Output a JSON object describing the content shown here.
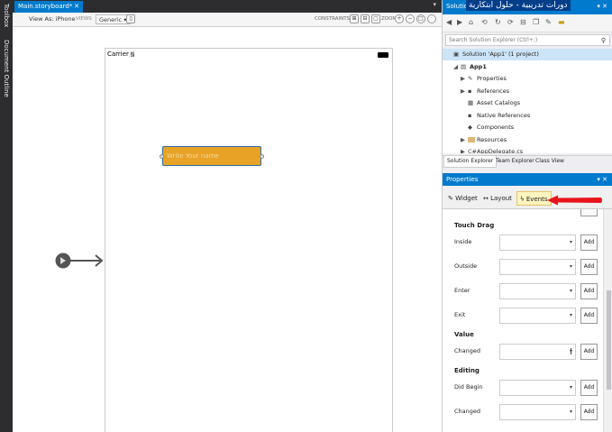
{
  "left_strip": {
    "tabs": [
      "Toolbox",
      "Document Outline"
    ]
  },
  "document": {
    "tab_title": "Main.storyboard*",
    "tab_close": "✕",
    "toolbar": {
      "device": "View As: iPhone",
      "views_label": "VIEWS",
      "views_value": "Generic ▾",
      "constraints_label": "CONSTRAINTS",
      "zoom_label": "ZOOM"
    },
    "canvas": {
      "carrier": "Carrier",
      "text_field_placeholder": "Write Your name"
    }
  },
  "solution_explorer": {
    "title": "Solution",
    "overlay": "دورات تدريبية - حلول ابتكارية",
    "search_placeholder": "Search Solution Explorer (Ctrl+;)",
    "tree": [
      {
        "label": "Solution 'App1' (1 project)",
        "indent": 0,
        "expand": "",
        "glyph": "▣",
        "selected": true
      },
      {
        "label": "App1",
        "indent": 1,
        "expand": "◢",
        "glyph": "▤",
        "bold": true
      },
      {
        "label": "Properties",
        "indent": 2,
        "expand": "▶",
        "glyph": "✎"
      },
      {
        "label": "References",
        "indent": 2,
        "expand": "▶",
        "glyph": "▪"
      },
      {
        "label": "Asset Catalogs",
        "indent": 2,
        "expand": "",
        "glyph": "▦"
      },
      {
        "label": "Native References",
        "indent": 2,
        "expand": "",
        "glyph": "▪"
      },
      {
        "label": "Components",
        "indent": 2,
        "expand": "",
        "glyph": "◆"
      },
      {
        "label": "Resources",
        "indent": 2,
        "expand": "▶",
        "glyph": "folder"
      },
      {
        "label": "AppDelegate.cs",
        "indent": 2,
        "expand": "▶",
        "glyph": "C#"
      }
    ],
    "tabs": [
      "Solution Explorer",
      "Team Explorer",
      "Class View"
    ]
  },
  "properties": {
    "title": "Properties",
    "tabs": [
      "Widget",
      "Layout",
      "Events"
    ],
    "active_tab": "Events",
    "sections": [
      {
        "title": "Touch Drag",
        "rows": [
          "Inside",
          "Outside",
          "Enter",
          "Exit"
        ]
      },
      {
        "title": "Value",
        "rows": [
          "Changed"
        ]
      },
      {
        "title": "Editing",
        "rows": [
          "Did Begin",
          "Changed"
        ]
      }
    ],
    "add_label": "Add",
    "colors": {
      "accent": "#007acc",
      "active_tab": "#fdf4bf",
      "arrow": "#e8141b"
    }
  }
}
